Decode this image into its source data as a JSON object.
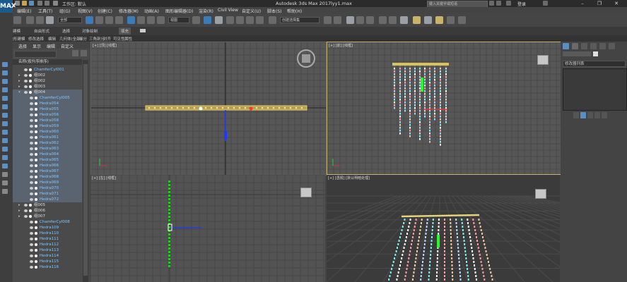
{
  "app": {
    "logo": "MAX",
    "workspace_label": "工作区: 默认",
    "title": "Autodesk 3ds Max 2017",
    "file": "lyy1.max",
    "search_placeholder": "键入关键字或短语",
    "login_label": "登录",
    "window_buttons": [
      "–",
      "❐",
      "✕"
    ]
  },
  "menu": {
    "items": [
      "编辑(E)",
      "工具(T)",
      "组(G)",
      "视图(V)",
      "创建(C)",
      "修改器(M)",
      "动画(A)",
      "图形编辑器(D)",
      "渲染(R)",
      "Civil View",
      "自定义(U)",
      "脚本(S)",
      "帮助(H)"
    ]
  },
  "toolbar": {
    "filter_value": "全部",
    "refcoord_value": "视图",
    "selection_set_placeholder": "创建选择集"
  },
  "ribbon": {
    "tabs": [
      "建模",
      "自由形式",
      "选择",
      "对象绘制",
      "填充"
    ],
    "sub_items": [
      "多边形建模",
      "修改选择",
      "编辑",
      "几何体(全部)",
      "细分",
      "三角剖分",
      "对齐",
      "可见性",
      "属性"
    ]
  },
  "scene_explorer": {
    "tabs": [
      "选择",
      "显示",
      "编辑",
      "自定义"
    ],
    "header": "名称(按升序排序)",
    "rows": [
      {
        "label": "ChamferCyl001",
        "kind": "obj",
        "indent": 1,
        "selected": false
      },
      {
        "label": "组002",
        "kind": "grp",
        "indent": 1,
        "selected": false
      },
      {
        "label": "组002",
        "kind": "grp",
        "indent": 1,
        "selected": false
      },
      {
        "label": "组003",
        "kind": "grp",
        "indent": 1,
        "selected": false
      },
      {
        "label": "组004",
        "kind": "grp",
        "indent": 1,
        "selected": true
      },
      {
        "label": "ChamferCyl005",
        "kind": "obj",
        "indent": 2,
        "selected": true
      },
      {
        "label": "Hedra054",
        "kind": "obj",
        "indent": 2,
        "selected": true
      },
      {
        "label": "Hedra055",
        "kind": "obj",
        "indent": 2,
        "selected": true
      },
      {
        "label": "Hedra056",
        "kind": "obj",
        "indent": 2,
        "selected": true
      },
      {
        "label": "Hedra058",
        "kind": "obj",
        "indent": 2,
        "selected": true
      },
      {
        "label": "Hedra059",
        "kind": "obj",
        "indent": 2,
        "selected": true
      },
      {
        "label": "Hedra060",
        "kind": "obj",
        "indent": 2,
        "selected": true
      },
      {
        "label": "Hedra061",
        "kind": "obj",
        "indent": 2,
        "selected": true
      },
      {
        "label": "Hedra062",
        "kind": "obj",
        "indent": 2,
        "selected": true
      },
      {
        "label": "Hedra063",
        "kind": "obj",
        "indent": 2,
        "selected": true
      },
      {
        "label": "Hedra064",
        "kind": "obj",
        "indent": 2,
        "selected": true
      },
      {
        "label": "Hedra065",
        "kind": "obj",
        "indent": 2,
        "selected": true
      },
      {
        "label": "Hedra066",
        "kind": "obj",
        "indent": 2,
        "selected": true
      },
      {
        "label": "Hedra067",
        "kind": "obj",
        "indent": 2,
        "selected": true
      },
      {
        "label": "Hedra068",
        "kind": "obj",
        "indent": 2,
        "selected": true
      },
      {
        "label": "Hedra069",
        "kind": "obj",
        "indent": 2,
        "selected": true
      },
      {
        "label": "Hedra070",
        "kind": "obj",
        "indent": 2,
        "selected": true
      },
      {
        "label": "Hedra071",
        "kind": "obj",
        "indent": 2,
        "selected": true
      },
      {
        "label": "Hedra072",
        "kind": "obj",
        "indent": 2,
        "selected": true
      },
      {
        "label": "组005",
        "kind": "grp",
        "indent": 1,
        "selected": false
      },
      {
        "label": "组006",
        "kind": "grp",
        "indent": 1,
        "selected": false
      },
      {
        "label": "组007",
        "kind": "grp",
        "indent": 1,
        "selected": false
      },
      {
        "label": "ChamferCyl008",
        "kind": "obj",
        "indent": 2,
        "selected": false
      },
      {
        "label": "Hedra109",
        "kind": "obj",
        "indent": 2,
        "selected": false
      },
      {
        "label": "Hedra110",
        "kind": "obj",
        "indent": 2,
        "selected": false
      },
      {
        "label": "Hedra111",
        "kind": "obj",
        "indent": 2,
        "selected": false
      },
      {
        "label": "Hedra112",
        "kind": "obj",
        "indent": 2,
        "selected": false
      },
      {
        "label": "Hedra113",
        "kind": "obj",
        "indent": 2,
        "selected": false
      },
      {
        "label": "Hedra114",
        "kind": "obj",
        "indent": 2,
        "selected": false
      },
      {
        "label": "Hedra115",
        "kind": "obj",
        "indent": 2,
        "selected": false
      },
      {
        "label": "Hedra116",
        "kind": "obj",
        "indent": 2,
        "selected": false
      }
    ]
  },
  "viewports": {
    "top": "[+] [顶] [线框]",
    "front": "[+] [前] [线框]",
    "left": "[+] [左] [线框]",
    "persp": "[+] [透视] [默认明暗处理]"
  },
  "command_panel": {
    "modifier_list": "修改器列表"
  }
}
